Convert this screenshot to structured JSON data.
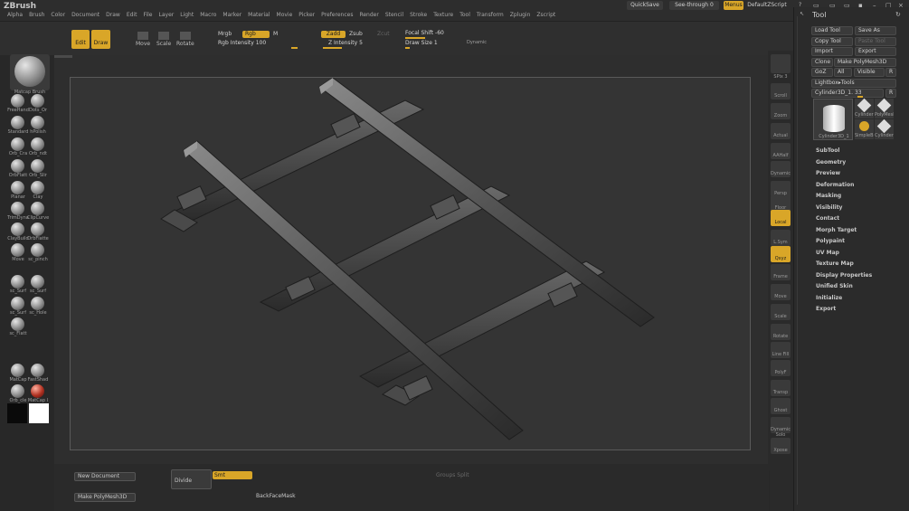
{
  "app": {
    "title": "ZBrush"
  },
  "menubar": {
    "menus": [
      "Alpha",
      "Brush",
      "Color",
      "Document",
      "Draw",
      "Edit",
      "File",
      "Layer",
      "Light",
      "Macro",
      "Marker",
      "Material",
      "Movie",
      "Picker",
      "Preferences",
      "Render",
      "Stencil",
      "Stroke",
      "Texture",
      "Tool",
      "Transform",
      "Zplugin",
      "Zscript"
    ],
    "quicksave": "QuickSave",
    "see_through_label": "See-through",
    "see_through_value": "0",
    "menus_label": "Menus",
    "script": "DefaultZScript"
  },
  "toolbar": {
    "edit": "Edit",
    "draw": "Draw",
    "move": "Move",
    "scale": "Scale",
    "rotate": "Rotate",
    "mrgb": "Mrgb",
    "rgb": "Rgb",
    "m": "M",
    "rgb_intensity_label": "Rgb Intensity",
    "rgb_intensity_value": "100",
    "zadd": "Zadd",
    "zsub": "Zsub",
    "zcut": "Zcut",
    "z_intensity_label": "Z Intensity",
    "z_intensity_value": "5",
    "focal_shift_label": "Focal Shift",
    "focal_shift_value": "-60",
    "draw_size_label": "Draw Size",
    "draw_size_value": "1",
    "dynamic": "Dynamic"
  },
  "leftbar": {
    "current_brush": "Matcap Brush",
    "brushes": [
      "FreeHand",
      "Dots_Or",
      "Standard",
      "hPolish",
      "Orb_Cra",
      "Orb_ndt",
      "OrbFlatt",
      "Orb_Slir",
      "Planar",
      "Clay",
      "TrimDyna",
      "ClipCurve",
      "ClayBuild",
      "OrbFlatte",
      "Move",
      "sc_pinch",
      "sc_Surf",
      "sc_Surf",
      "sc_Surf",
      "sc_Hole",
      "sc_Flatt",
      "MatCap",
      "FastShad",
      "Orb_cle",
      "MatCap I"
    ]
  },
  "rightshelf": {
    "spix_label": "SPix",
    "spix_value": "3",
    "buttons": [
      "Scroll",
      "Zoom",
      "Actual",
      "AAHalf",
      "Dynamic",
      "Persp",
      "Floor",
      "Local",
      "L.Sym",
      "Qxyz",
      "Frame",
      "Move",
      "Scale",
      "Rotate",
      "Line Fill",
      "PolyF",
      "Transp",
      "Ghost",
      "Dynamic Solo",
      "Xpose"
    ]
  },
  "tool_panel": {
    "title": "Tool",
    "load_tool": "Load Tool",
    "save_as": "Save As",
    "copy_tool": "Copy Tool",
    "paste_tool": "Paste Tool",
    "import": "Import",
    "export": "Export",
    "clone": "Clone",
    "make_polymesh": "Make PolyMesh3D",
    "goz": "GoZ",
    "all": "All",
    "visible": "Visible",
    "r": "R",
    "lightbox_tools": "Lightbox▸Tools",
    "current_tool": "Cylinder3D_1.",
    "current_tool_value": "33",
    "thumbs": [
      "Cylinder3",
      "PolyMesh",
      "SimpleBr",
      "Cylinder"
    ],
    "thumb_main": "Cylinder3D_1",
    "sections": [
      "SubTool",
      "Geometry",
      "Preview",
      "Deformation",
      "Masking",
      "Visibility",
      "Contact",
      "Morph Target",
      "Polypaint",
      "UV Map",
      "Texture Map",
      "Display Properties",
      "Unified Skin",
      "Initialize",
      "Export"
    ]
  },
  "bottom": {
    "new_document": "New Document",
    "make_polymesh": "Make PolyMesh3D",
    "divide": "Divide",
    "smt": "Smt",
    "groups_split": "Groups Split",
    "backface_mask": "BackFaceMask"
  },
  "colors": {
    "accent": "#d9a628",
    "bg": "#282828",
    "canvas": "#343434"
  }
}
